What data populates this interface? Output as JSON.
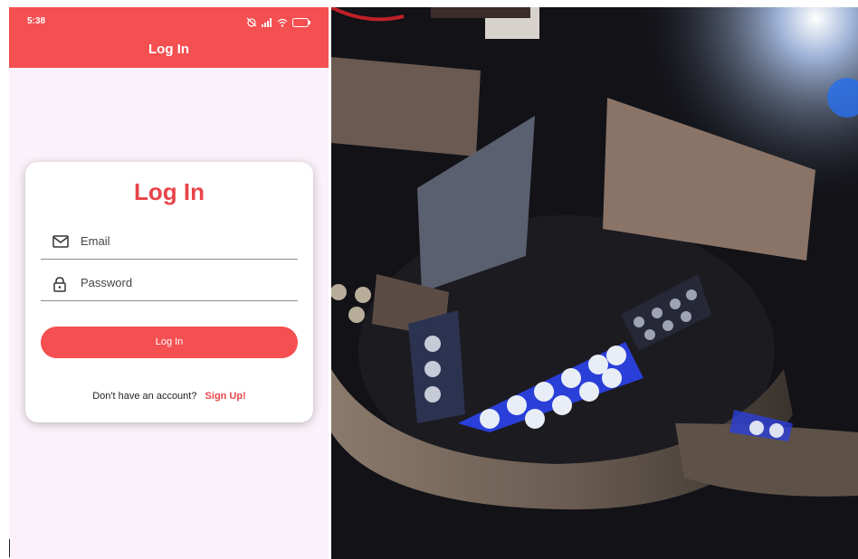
{
  "status_bar": {
    "time": "5:38",
    "icons": [
      "alarm-off-icon",
      "signal-icon",
      "wifi-icon",
      "battery-icon"
    ],
    "battery_text": "100"
  },
  "app_bar": {
    "title": "Log In",
    "color": "#f44f51"
  },
  "login_card": {
    "title": "Log In",
    "email_label": "Email",
    "password_label": "Password",
    "button_label": "Log In",
    "signup_prompt": "Don't have an account?",
    "signup_link": "Sign Up!"
  },
  "colors": {
    "accent": "#f44f51",
    "background": "#fbf1fa"
  }
}
